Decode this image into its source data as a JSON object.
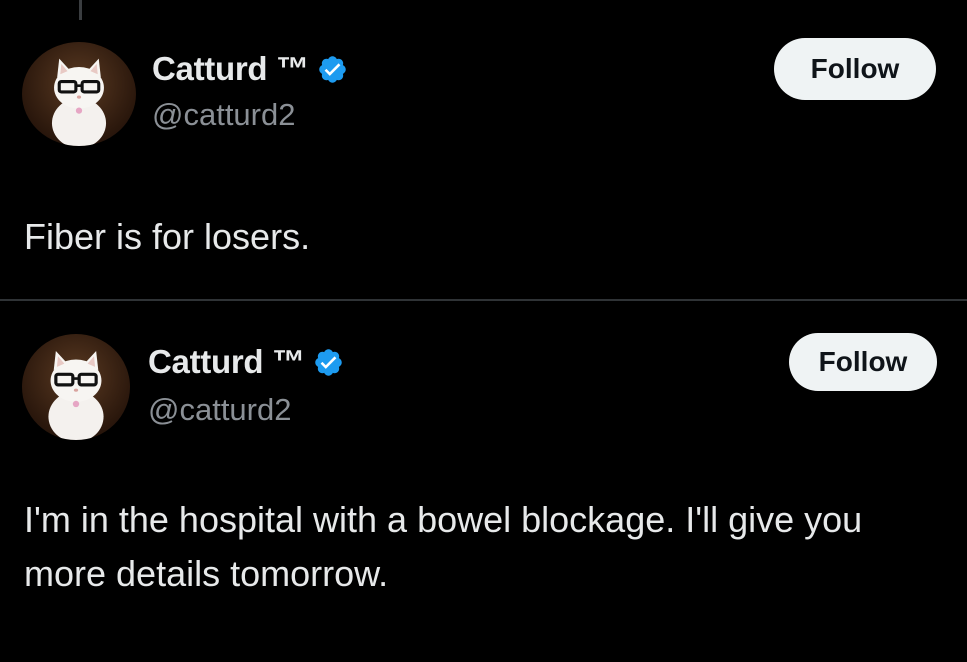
{
  "tweets": [
    {
      "display_name": "Catturd ™",
      "handle": "@catturd2",
      "follow_label": "Follow",
      "text": "Fiber is for losers.",
      "verified": true
    },
    {
      "display_name": "Catturd ™",
      "handle": "@catturd2",
      "follow_label": "Follow",
      "text": "I'm in the hospital with a bowel blockage. I'll give you more details tomorrow.",
      "verified": true
    }
  ],
  "colors": {
    "background": "#000000",
    "text": "#e7e9ea",
    "handle": "#8b9096",
    "verified": "#1d9bf0",
    "follow_bg": "#eff3f4",
    "follow_text": "#0f1419",
    "divider": "#2f3336"
  },
  "icons": {
    "verified": "verified-badge-icon",
    "avatar": "cat-with-glasses-avatar"
  }
}
